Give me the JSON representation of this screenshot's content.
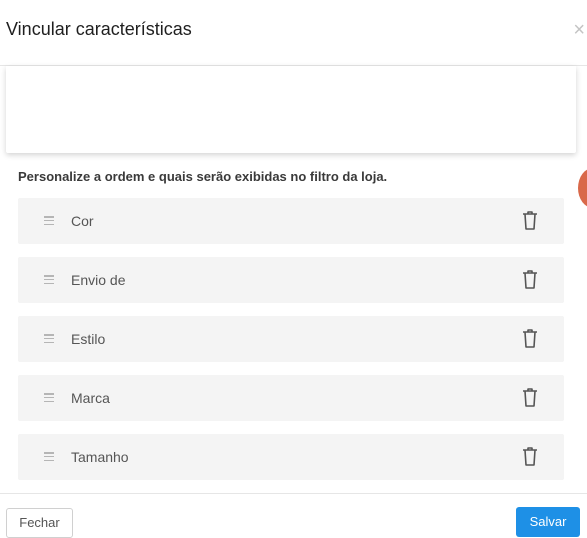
{
  "modal": {
    "title": "Vincular características",
    "close_symbol": "×"
  },
  "description": "Personalize a ordem e quais serão exibidas no filtro da loja.",
  "items": [
    {
      "label": "Cor"
    },
    {
      "label": "Envio de"
    },
    {
      "label": "Estilo"
    },
    {
      "label": "Marca"
    },
    {
      "label": "Tamanho"
    }
  ],
  "footer": {
    "close_label": "Fechar",
    "save_label": "Salvar"
  },
  "colors": {
    "primary": "#1e90e6",
    "item_bg": "#f4f4f4",
    "accent_orange": "#d9694a"
  }
}
